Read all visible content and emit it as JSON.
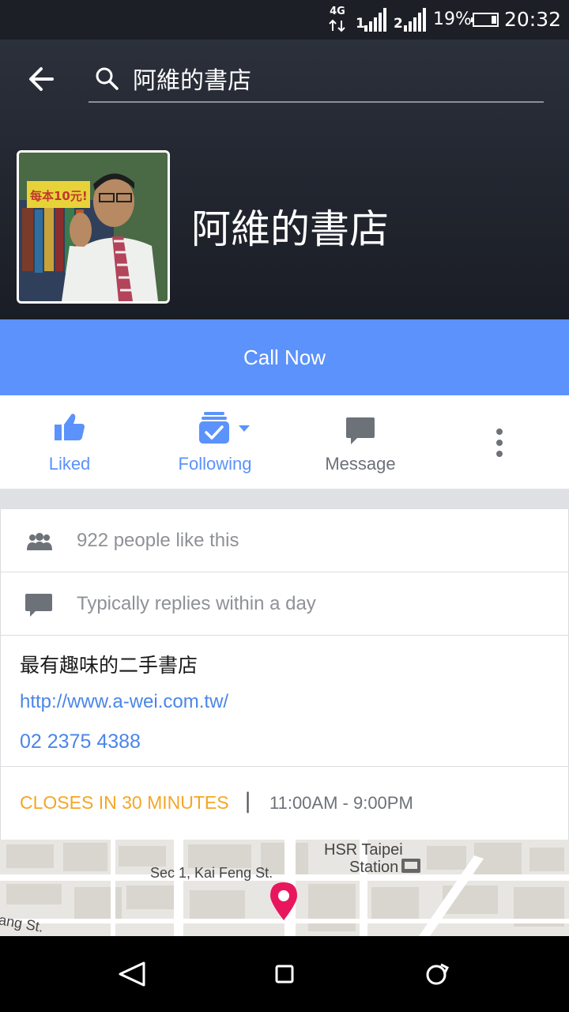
{
  "status_bar": {
    "network": "4G",
    "sim1": "1",
    "sim2": "2",
    "battery": "19%",
    "time": "20:32"
  },
  "search": {
    "query": "阿維的書店"
  },
  "page": {
    "title": "阿維的書店",
    "avatar_sign": "每本10元!"
  },
  "call_now": {
    "label": "Call Now"
  },
  "actions": {
    "liked": "Liked",
    "following": "Following",
    "message": "Message"
  },
  "info": {
    "likes": "922 people like this",
    "replies": "Typically replies within a day",
    "description": "最有趣味的二手書店",
    "website": "http://www.a-wei.com.tw/",
    "phone": "02 2375 4388",
    "closes": "CLOSES IN 30 MINUTES",
    "separator": "|",
    "hours": "11:00AM - 9:00PM"
  },
  "map": {
    "label_station_1": "HSR Taipei",
    "label_station_2": "Station",
    "label_street": "Sec 1, Kai Feng St.",
    "label_street_2": "ang St."
  },
  "colors": {
    "accent": "#5b92fb",
    "header_bg": "#1f232c",
    "closes": "#f5a623",
    "link": "#4a86e8",
    "pin": "#e8175d"
  }
}
